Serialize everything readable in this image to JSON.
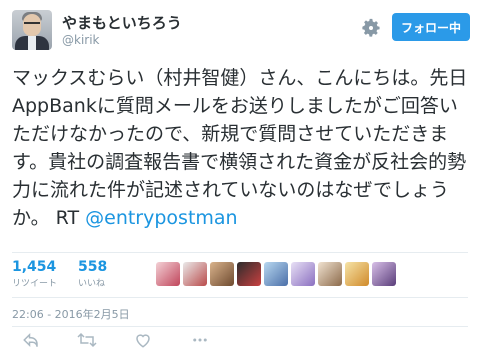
{
  "author": {
    "display_name": "やまもといちろう",
    "handle": "@kirik"
  },
  "header": {
    "follow_label": "フォロー中",
    "settings_icon": "gear-icon"
  },
  "tweet": {
    "text": "マックスむらい（村井智健）さん、こんにちは。先日AppBankに質問メールをお送りしましたがご回答いただけなかったので、新規で質問させていただきます。貴社の調査報告書で横領された資金が反社会的勢力に流れた件が記述されていないのはなぜでしょうか。 RT ",
    "mention": "@entrypostman"
  },
  "stats": {
    "retweets_count": "1,454",
    "retweets_label": "リツイート",
    "likes_count": "558",
    "likes_label": "いいね"
  },
  "timestamp": "22:06 - 2016年2月5日",
  "colors": {
    "accent": "#1b95e0",
    "follow_button": "#2b9ae8",
    "muted": "#8899a6"
  },
  "actions": [
    "reply-icon",
    "retweet-icon",
    "like-icon",
    "more-icon"
  ]
}
